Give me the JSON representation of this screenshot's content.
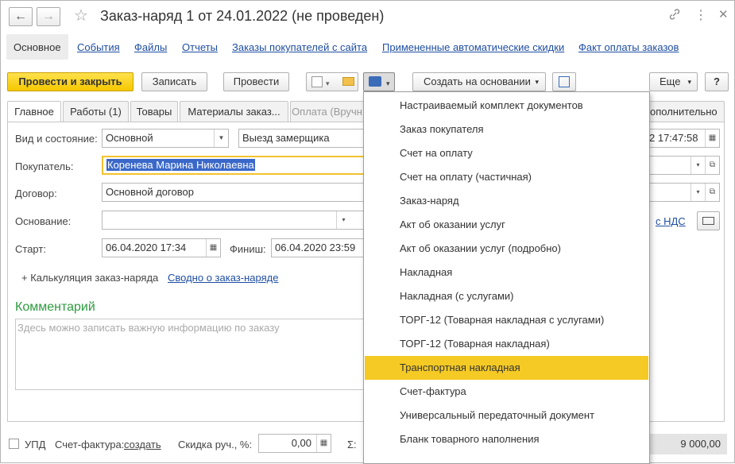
{
  "window": {
    "title": "Заказ-наряд 1 от 24.01.2022 (не проведен)",
    "back": "←",
    "forward": "→",
    "star": "☆",
    "link_icon": "🔗",
    "more_icon": "⋮",
    "maximize_icon": "□",
    "close_icon": "✕"
  },
  "panel_tabs": [
    "Основное",
    "События",
    "Файлы",
    "Отчеты",
    "Заказы покупателей с сайта",
    "Примененные автоматические скидки",
    "Факт оплаты заказов"
  ],
  "toolbar": {
    "post_close": "Провести и закрыть",
    "save": "Записать",
    "post": "Провести",
    "create_based": "Создать на основании",
    "more": "Еще",
    "help": "?"
  },
  "tabs": [
    "Главное",
    "Работы (1)",
    "Товары",
    "Материалы заказ...",
    "Оплата (Вручн",
    "ополнительно"
  ],
  "form": {
    "kind_label": "Вид и состояние:",
    "kind_value": "Основной",
    "state_value": "Выезд замерщика",
    "date_tail": "2 17:47:58",
    "buyer_label": "Покупатель:",
    "buyer_value": "Коренева Марина Николаевна",
    "contract_label": "Договор:",
    "contract_value": "Основной договор",
    "basis_label": "Основание:",
    "basis_value": "",
    "vat_link": "с НДС",
    "start_label": "Старт:",
    "start_value": "06.04.2020 17:34",
    "finish_label": "Финиш:",
    "finish_value": "06.04.2020 23:59",
    "calc_label": "+ Калькуляция заказ-наряда",
    "summary_link": "Сводно о заказ-наряде",
    "comment_title": "Комментарий",
    "comment_placeholder": "Здесь можно записать важную информацию по заказу"
  },
  "menu": [
    "Настраиваемый комплект документов",
    "Заказ покупателя",
    "Счет на оплату",
    "Счет на оплату (частичная)",
    "Заказ-наряд",
    "Акт об оказании услуг",
    "Акт об оказании услуг (подробно)",
    "Накладная",
    "Накладная (с услугами)",
    "ТОРГ-12 (Товарная накладная с услугами)",
    "ТОРГ-12 (Товарная накладная)",
    "Транспортная накладная",
    "Счет-фактура",
    "Универсальный передаточный документ",
    "Бланк товарного наполнения"
  ],
  "menu_highlight": "Транспортная накладная",
  "footer": {
    "upd_label": "УПД",
    "invoice_label": "Счет-фактура:",
    "invoice_link": "создать",
    "discount_label": "Скидка руч., %:",
    "discount_value": "0,00",
    "sigma": "Σ:",
    "total": "9 000,00"
  },
  "colors": {
    "primary": "#f5c800",
    "highlight": "#f5ca24",
    "link": "#1f4ea3",
    "section": "#2e9a3f"
  }
}
